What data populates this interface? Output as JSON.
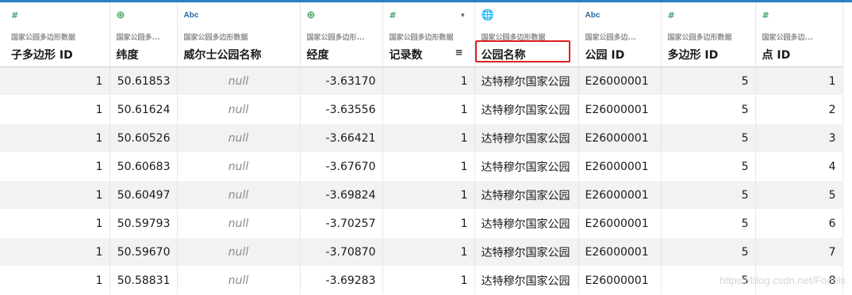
{
  "columns": [
    {
      "type_icon": "#",
      "source": "国家公园多边形数据",
      "title": "子多边形 ID"
    },
    {
      "type_icon": "⊕",
      "source": "国家公园多...",
      "title": "纬度"
    },
    {
      "type_icon": "Abc",
      "source": "国家公园多边形数据",
      "title": "威尔士公园名称"
    },
    {
      "type_icon": "⊕",
      "source": "国家公园多边形...",
      "title": "经度"
    },
    {
      "type_icon": "#",
      "source": "国家公园多边形数据",
      "title": "记录数",
      "sort_icon": "≡",
      "dropdown_icon": "▾"
    },
    {
      "type_icon": "🌐",
      "source": "国家公园多边形数据",
      "title": "公园名称",
      "highlighted": true
    },
    {
      "type_icon": "Abc",
      "source": "国家公园多边...",
      "title": "公园 ID"
    },
    {
      "type_icon": "#",
      "source": "国家公园多边形数据",
      "title": "多边形 ID"
    },
    {
      "type_icon": "#",
      "source": "国家公园多边...",
      "title": "点 ID"
    }
  ],
  "rows": [
    [
      "1",
      "50.61853",
      "null",
      "-3.63170",
      "1",
      "达特穆尔国家公园",
      "E26000001",
      "5",
      "1"
    ],
    [
      "1",
      "50.61624",
      "null",
      "-3.63556",
      "1",
      "达特穆尔国家公园",
      "E26000001",
      "5",
      "2"
    ],
    [
      "1",
      "50.60526",
      "null",
      "-3.66421",
      "1",
      "达特穆尔国家公园",
      "E26000001",
      "5",
      "3"
    ],
    [
      "1",
      "50.60683",
      "null",
      "-3.67670",
      "1",
      "达特穆尔国家公园",
      "E26000001",
      "5",
      "4"
    ],
    [
      "1",
      "50.60497",
      "null",
      "-3.69824",
      "1",
      "达特穆尔国家公园",
      "E26000001",
      "5",
      "5"
    ],
    [
      "1",
      "50.59793",
      "null",
      "-3.70257",
      "1",
      "达特穆尔国家公园",
      "E26000001",
      "5",
      "6"
    ],
    [
      "1",
      "50.59670",
      "null",
      "-3.70870",
      "1",
      "达特穆尔国家公园",
      "E26000001",
      "5",
      "7"
    ],
    [
      "1",
      "50.58831",
      "null",
      "-3.69283",
      "1",
      "达特穆尔国家公园",
      "E26000001",
      "5",
      "8"
    ]
  ],
  "watermark": "https://blog.csdn.net/Foools",
  "colors": {
    "accent": "#2f7fc1",
    "highlight": "#e02020",
    "stripe": "#f2f2f2",
    "null_text": "#8a8a8a"
  }
}
